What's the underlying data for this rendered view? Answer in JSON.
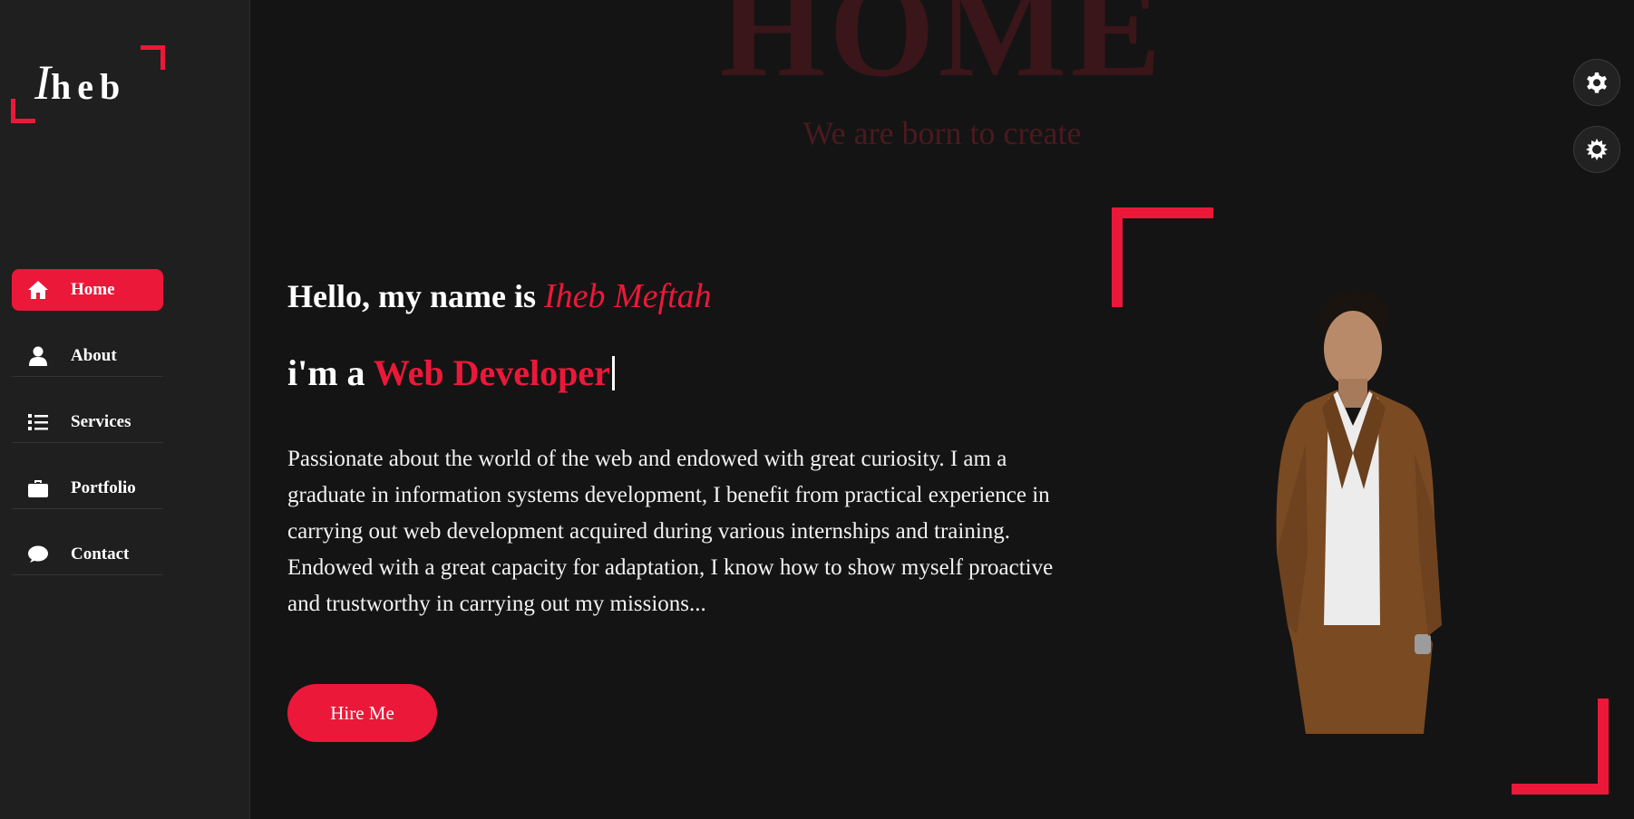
{
  "logo": {
    "first_letter": "I",
    "rest": "heb"
  },
  "nav": {
    "items": [
      {
        "label": "Home",
        "icon": "home-icon",
        "active": true
      },
      {
        "label": "About",
        "icon": "user-icon",
        "active": false
      },
      {
        "label": "Services",
        "icon": "list-icon",
        "active": false
      },
      {
        "label": "Portfolio",
        "icon": "briefcase-icon",
        "active": false
      },
      {
        "label": "Contact",
        "icon": "comment-icon",
        "active": false
      }
    ]
  },
  "hero": {
    "title": "HOME",
    "subtitle": "We are born to create",
    "greeting_prefix": "Hello, my name is ",
    "name": "Iheb Meftah",
    "role_prefix": "i'm a ",
    "role": "Web Developer",
    "bio": "Passionate about the world of the web and endowed with great curiosity. I am a graduate in information systems development, I benefit from practical experience in carrying out web development acquired during various internships and training. Endowed with a great capacity for adaptation, I know how to show myself proactive and trustworthy in carrying out my missions...",
    "hire_label": "Hire Me"
  },
  "toolbar": {
    "buttons": [
      {
        "icon": "gear-icon"
      },
      {
        "icon": "sun-icon"
      }
    ]
  },
  "colors": {
    "accent": "#ec1839",
    "background": "#141414",
    "sidebar": "#1f1f1f"
  }
}
